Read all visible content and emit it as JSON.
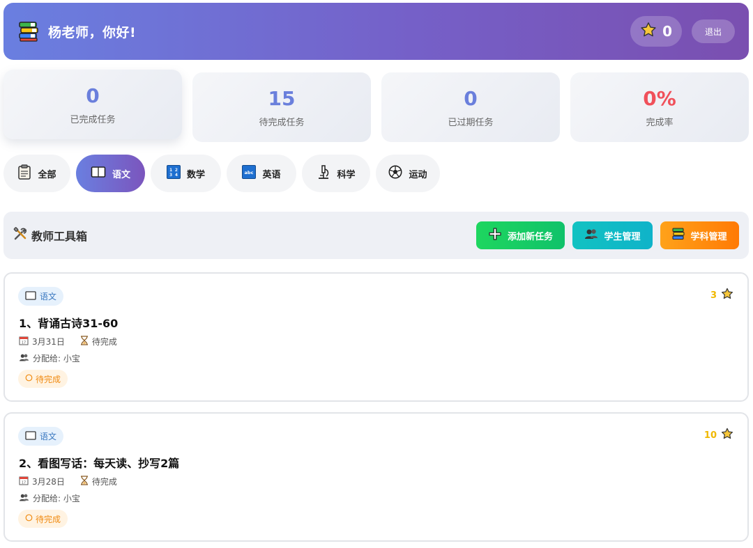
{
  "header": {
    "greeting": "杨老师，你好!",
    "stars": "0",
    "logout_label": "退出"
  },
  "stats": [
    {
      "value": "0",
      "label": "已完成任务"
    },
    {
      "value": "15",
      "label": "待完成任务"
    },
    {
      "value": "0",
      "label": "已过期任务"
    },
    {
      "value": "0%",
      "label": "完成率"
    }
  ],
  "tabs": [
    {
      "label": "全部",
      "icon": "clipboard-icon",
      "active": false
    },
    {
      "label": "语文",
      "icon": "book-icon",
      "active": true
    },
    {
      "label": "数学",
      "icon": "numbers-icon",
      "active": false
    },
    {
      "label": "英语",
      "icon": "abc-icon",
      "active": false
    },
    {
      "label": "科学",
      "icon": "microscope-icon",
      "active": false
    },
    {
      "label": "运动",
      "icon": "soccer-ball-icon",
      "active": false
    }
  ],
  "toolbox": {
    "title": "教师工具箱",
    "add_task_label": "添加新任务",
    "students_label": "学生管理",
    "subjects_label": "学科管理"
  },
  "tasks": [
    {
      "subject": "语文",
      "title": "1、背诵古诗31-60",
      "date": "3月31日",
      "state": "待完成",
      "assignee": "分配给: 小宝",
      "status": "待完成",
      "points": "3"
    },
    {
      "subject": "语文",
      "title": "2、看图写话：每天读、抄写2篇",
      "date": "3月28日",
      "state": "待完成",
      "assignee": "分配给: 小宝",
      "status": "待完成",
      "points": "10"
    }
  ],
  "colors": {
    "accent_start": "#6a7fe0",
    "accent_end": "#7a4fb0",
    "stat_blue": "#6a7fdc",
    "stat_red": "#f0505a",
    "green_button": "#1ed65f",
    "teal_button": "#12c2c2",
    "orange_button": "#ff8a0a",
    "pending_orange": "#f08a10",
    "star_gold": "#f0b800"
  }
}
